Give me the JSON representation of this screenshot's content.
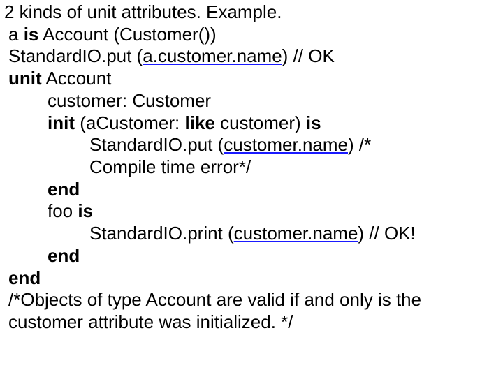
{
  "lines": {
    "l1": "2 kinds of unit attributes. Example.",
    "l2_pre": "a ",
    "l2_is": "is",
    "l2_post": " Account (Customer())",
    "l3_pre": "StandardIO.put (",
    "l3_u": "a.customer.name",
    "l3_post": ") // OK",
    "l4_unit": "unit",
    "l4_post": " Account",
    "l5": "customer: Customer",
    "l6_init": "init",
    "l6_mid": " (aCustomer: ",
    "l6_like": "like",
    "l6_cust": " customer) ",
    "l6_is": "is",
    "l7_pre": "StandardIO.put (",
    "l7_u": "customer.name",
    "l7_post": ") /*",
    "l8": "Compile time error*/",
    "l9": "end",
    "l10_pre": "foo ",
    "l10_is": "is",
    "l11_pre": "StandardIO.print (",
    "l11_u": "customer.name",
    "l11_post": ") // OK!",
    "l12": "end",
    "l13": "end",
    "l14": "/*Objects of type Account are valid if and only is the",
    "l15": "customer attribute was initialized. */"
  }
}
